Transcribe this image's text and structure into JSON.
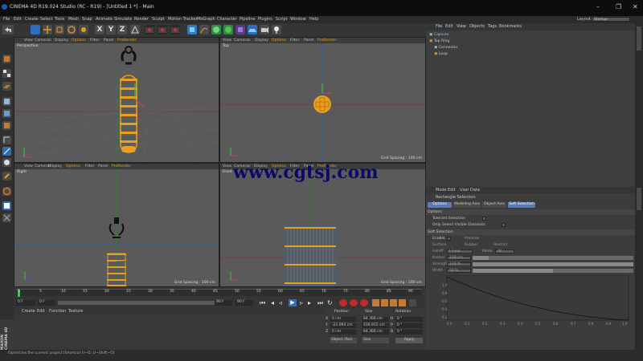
{
  "window": {
    "title": "CINEMA 4D R19.024 Studio (RC - R19) - [Untitled 1 *] - Main"
  },
  "menu": [
    "File",
    "Edit",
    "Create",
    "Select",
    "Tools",
    "Mesh",
    "Snap",
    "Animate",
    "Simulate",
    "Render",
    "Sculpt",
    "Motion Tracker",
    "MoGraph",
    "Character",
    "Pipeline",
    "Plugins",
    "Script",
    "Window",
    "Help"
  ],
  "layout": {
    "label": "Layout:",
    "value": "Startup"
  },
  "viewport_menu": [
    "View",
    "Cameras",
    "Display",
    "Options",
    "Filter",
    "Panel",
    "ProRender"
  ],
  "viewports": {
    "perspective": {
      "name": "Perspective"
    },
    "top": {
      "name": "Top",
      "grid": "Grid Spacing : 100 cm"
    },
    "right": {
      "name": "Right",
      "grid": "Grid Spacing : 100 cm"
    },
    "front": {
      "name": "Front",
      "grid": "Grid Spacing : 100 cm"
    }
  },
  "watermark": "www.cgtsj.com",
  "objects": {
    "menu": [
      "File",
      "Edit",
      "View",
      "Objects",
      "Tags",
      "Bookmarks"
    ],
    "items": [
      "Capsule",
      "Top Ring",
      "Connector",
      "Loop"
    ]
  },
  "attributes": {
    "menu": [
      "Mode",
      "Edit",
      "User Data"
    ],
    "title": "Rectangle Selection",
    "tabs": [
      "Options",
      "Modeling Axis",
      "Object Axis",
      "Soft Selection"
    ],
    "options_header": "Options",
    "tolerant": "Tolerant Selection",
    "only_visible": "Only Select Visible Elements",
    "soft_header": "Soft Selection",
    "rows": [
      "Enable",
      "Surface",
      "Falloff",
      "Radius",
      "Strength",
      "Width"
    ],
    "preview": "Preview",
    "rubber": "Rubber",
    "restrict": "Restrict",
    "falloff_value": "Linear",
    "mode_label": "Mode",
    "mode_value": "All",
    "radius_value": "100 cm",
    "strength_value": "100 %",
    "width_value": "50 %",
    "graph_x": [
      "0.0",
      "0.1",
      "0.2",
      "0.3",
      "0.4",
      "0.5",
      "0.6",
      "0.7",
      "0.8",
      "0.9",
      "1.0"
    ],
    "graph_y": [
      "1.0",
      "0.8",
      "0.6",
      "0.4",
      "0.2"
    ]
  },
  "timeline": {
    "ticks": [
      "0",
      "5",
      "10",
      "15",
      "20",
      "25",
      "30",
      "35",
      "40",
      "45",
      "50",
      "55",
      "60",
      "65",
      "70",
      "75",
      "80",
      "85",
      "90"
    ],
    "start": "0 F",
    "start2": "0 F",
    "end": "90 F",
    "end2": "90 F"
  },
  "material": {
    "menu": [
      "Create",
      "Edit",
      "Function",
      "Texture"
    ]
  },
  "coords": {
    "headers": [
      "Position",
      "Size",
      "Rotation"
    ],
    "rows": [
      {
        "axis": "X",
        "pos": "0 cm",
        "size": "84.366 cm",
        "rlabel": "H",
        "rot": "0 °"
      },
      {
        "axis": "Y",
        "pos": "-21.093 cm",
        "size": "436.915 cm",
        "rlabel": "P",
        "rot": "0 °"
      },
      {
        "axis": "Z",
        "pos": "0 cm",
        "size": "84.366 cm",
        "rlabel": "B",
        "rot": "0 °"
      }
    ],
    "mode": "Object (Rel)",
    "size_mode": "Size",
    "apply": "Apply"
  },
  "status": "Optimizes the current project [Shortcut U~O; U~Shift~O]",
  "brand": "MAXON CINEMA 4D"
}
